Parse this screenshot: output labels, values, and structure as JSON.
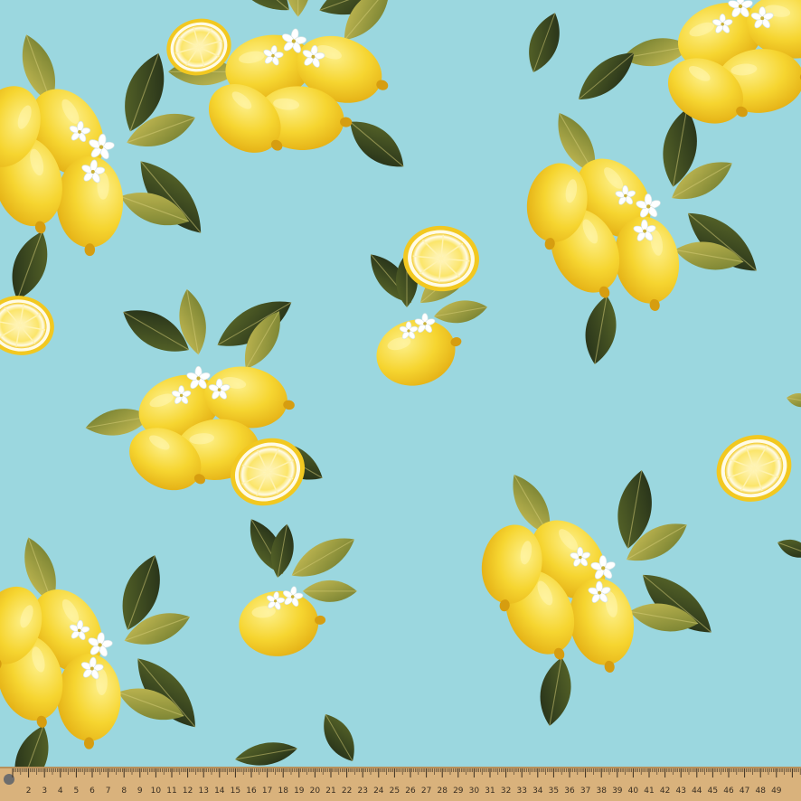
{
  "scene": {
    "subject": "lemon-print-fabric",
    "colors": {
      "fabric": "#9bd7df",
      "lemon": "#f6d530",
      "lemon_shade": "#e3ae14",
      "lemon_highlight": "#fdf08a",
      "leaf_dark": "#2d3b22",
      "leaf_mid": "#6f7b2e",
      "leaf_olive": "#a9a03a",
      "blossom": "#ffffff",
      "ruler": "#d9b27c",
      "ruler_ink": "#3a2f22"
    }
  },
  "ruler": {
    "numbers": [
      "2",
      "3",
      "4",
      "5",
      "6",
      "7",
      "8",
      "9",
      "10",
      "11",
      "12",
      "13",
      "14",
      "15",
      "16",
      "17",
      "18",
      "19",
      "20",
      "21",
      "22",
      "23",
      "24",
      "25",
      "26",
      "27",
      "28",
      "29",
      "30",
      "31",
      "32",
      "33",
      "34",
      "35",
      "36",
      "37",
      "38",
      "39",
      "40",
      "41",
      "42",
      "43",
      "44",
      "45",
      "46",
      "47",
      "48",
      "49"
    ]
  }
}
